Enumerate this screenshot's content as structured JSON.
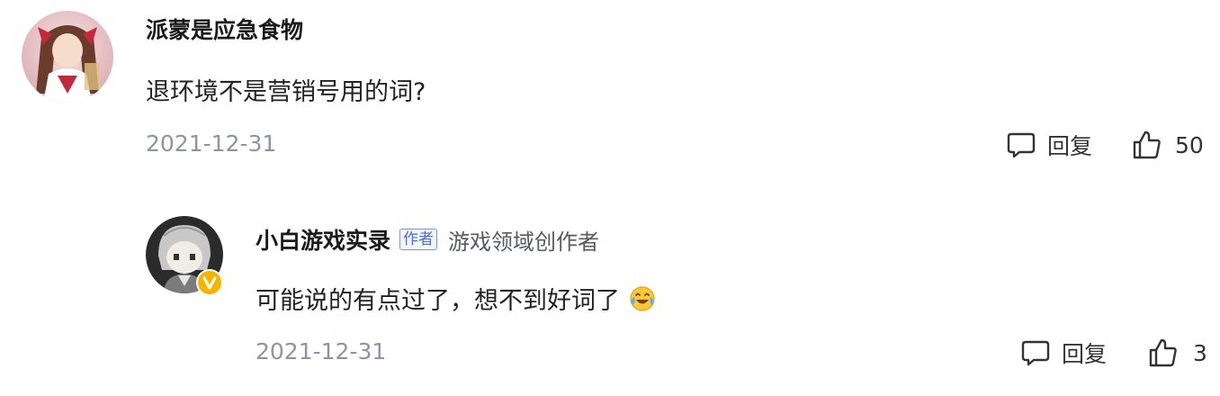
{
  "comments": [
    {
      "username": "派蒙是应急食物",
      "text": "退环境不是营销号用的词?",
      "date": "2021-12-31",
      "reply_label": "回复",
      "like_count": "50"
    },
    {
      "username": "小白游戏实录",
      "author_tag": "作者",
      "creator_title": "游戏领域创作者",
      "text": "可能说的有点过了，想不到好词了",
      "emoji": "laugh-cry-emoji",
      "date": "2021-12-31",
      "reply_label": "回复",
      "like_count": "3"
    }
  ],
  "colors": {
    "date_gray": "#8f93a6",
    "author_tag_blue": "#4a6fd6",
    "verified_gold": "#f6b400"
  },
  "icons": {
    "reply": "speech-bubble-icon",
    "like": "thumbs-up-icon",
    "verified": "verified-badge-icon"
  }
}
